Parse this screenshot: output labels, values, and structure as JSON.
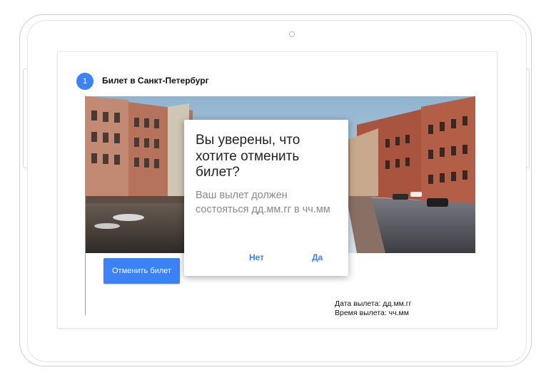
{
  "ticket": {
    "step_number": "1",
    "title": "Билет в Санкт-Петербург",
    "cancel_button_label": "Отменить билет",
    "departure_date": "Дата вылета: дд.мм.гг",
    "departure_time": "Время вылета: чч.мм"
  },
  "dialog": {
    "title": "Вы уверены, что хотите отменить билет?",
    "message": "Ваш вылет должен состояться дд.мм.гг в чч.мм",
    "no_label": "Нет",
    "yes_label": "Да"
  },
  "colors": {
    "accent": "#3b82f6",
    "dialog_text": "#8a8a8a"
  }
}
